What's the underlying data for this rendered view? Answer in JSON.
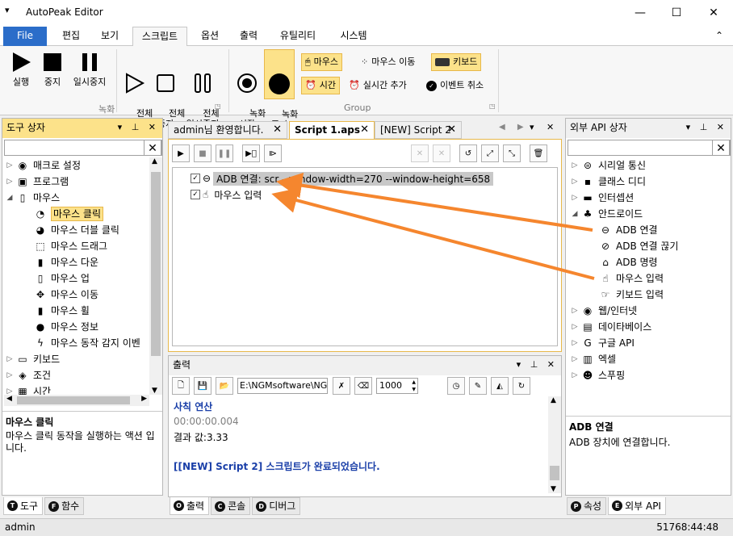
{
  "window": {
    "title": "AutoPeak Editor",
    "sysmenu_glyph": "▾",
    "min": "—",
    "max": "☐",
    "close": "✕"
  },
  "menu": {
    "file": "File",
    "tabs": [
      "편집",
      "보기",
      "스크립트",
      "옵션",
      "출력",
      "유틸리티",
      "시스템"
    ],
    "active": "스크립트",
    "collapse_glyph": "⌃"
  },
  "ribbon": {
    "run": "실행",
    "stop": "중지",
    "pause": "일시중지",
    "all_run": "전체\n실행",
    "all_stop": "전체\n중지",
    "all_pause": "전체\n일시중지",
    "rec_start": "녹화\n시작",
    "rec_stop": "녹화\n중지",
    "group_record": "녹화",
    "group_group": "Group",
    "mouse": "마우스",
    "mouse_move": "마우스 이동",
    "keyboard": "키보드",
    "time": "시간",
    "realtime_add": "실시간 추가",
    "event_cancel": "이벤트 취소"
  },
  "tool_panel": {
    "title": "도구 상자",
    "items": [
      {
        "label": "매크로 설정",
        "icon": "globe-icon",
        "glyph": "◉",
        "arrow": "▷",
        "indent": 0
      },
      {
        "label": "프로그램",
        "icon": "window-icon",
        "glyph": "▣",
        "arrow": "▷",
        "indent": 0
      },
      {
        "label": "마우스",
        "icon": "mouse-icon",
        "glyph": "▯",
        "arrow": "◢",
        "indent": 0
      },
      {
        "label": "마우스 클릭",
        "icon": "mouse-click-icon",
        "glyph": "◔",
        "arrow": "",
        "indent": 1,
        "highlight": true
      },
      {
        "label": "마우스 더블 클릭",
        "icon": "mouse-double-click-icon",
        "glyph": "◕",
        "arrow": "",
        "indent": 1
      },
      {
        "label": "마우스 드래그",
        "icon": "mouse-drag-icon",
        "glyph": "⬚",
        "arrow": "",
        "indent": 1
      },
      {
        "label": "마우스 다운",
        "icon": "mouse-down-icon",
        "glyph": "▮",
        "arrow": "",
        "indent": 1
      },
      {
        "label": "마우스 업",
        "icon": "mouse-up-icon",
        "glyph": "▯",
        "arrow": "",
        "indent": 1
      },
      {
        "label": "마우스 이동",
        "icon": "mouse-move-icon",
        "glyph": "✥",
        "arrow": "",
        "indent": 1
      },
      {
        "label": "마우스 휠",
        "icon": "mouse-wheel-icon",
        "glyph": "▮",
        "arrow": "",
        "indent": 1
      },
      {
        "label": "마우스 정보",
        "icon": "mouse-info-icon",
        "glyph": "●",
        "arrow": "",
        "indent": 1
      },
      {
        "label": "마우스 동작 감지 이벤",
        "icon": "bolt-icon",
        "glyph": "ϟ",
        "arrow": "",
        "indent": 1
      },
      {
        "label": "키보드",
        "icon": "keyboard-icon",
        "glyph": "▭",
        "arrow": "▷",
        "indent": 0
      },
      {
        "label": "조건",
        "icon": "condition-icon",
        "glyph": "◈",
        "arrow": "▷",
        "indent": 0
      },
      {
        "label": "시간",
        "icon": "calendar-icon",
        "glyph": "▦",
        "arrow": "▷",
        "indent": 0
      }
    ],
    "desc_title": "마우스 클릭",
    "desc_body": "마우스 클릭 동작을 실행하는 액션 입니다.",
    "tab_tool": "도구",
    "tab_tool_key": "T",
    "tab_func": "함수",
    "tab_func_key": "F"
  },
  "doc_tabs": [
    {
      "label": "admin님 환영합니다."
    },
    {
      "label": "Script 1.aps"
    },
    {
      "label": "[NEW] Script 2"
    }
  ],
  "script": {
    "lines": [
      {
        "text": "ADB 연결: scr    --window-width=270 --window-height=658",
        "icon": "link-icon"
      },
      {
        "text": "마우스 입력",
        "icon": "hand-pointer-icon"
      }
    ],
    "check": "✓"
  },
  "output": {
    "title": "출력",
    "path": "E:\\NGMsoftware\\NG",
    "number": "1000",
    "lines": [
      {
        "text": "사칙 연산",
        "color": "#1a3fa8",
        "bold": true
      },
      {
        "text": "00:00:00.004",
        "color": "#808080",
        "bold": false
      },
      {
        "text": "결과 값:3.33",
        "color": "#000000",
        "bold": false
      },
      {
        "text": "",
        "color": "#000000",
        "bold": false
      },
      {
        "text": "[[NEW] Script 2] 스크립트가 완료되었습니다.",
        "color": "#1a3fa8",
        "bold": true
      }
    ],
    "tab_output": "출력",
    "tab_output_key": "O",
    "tab_console": "콘솔",
    "tab_console_key": "C",
    "tab_debug": "디버그",
    "tab_debug_key": "D"
  },
  "api_panel": {
    "title": "외부 API 상자",
    "items": [
      {
        "label": "시리얼 통신",
        "icon": "serial-icon",
        "glyph": "⊜",
        "arrow": "▷",
        "indent": 0
      },
      {
        "label": "클래스 디디",
        "icon": "class-icon",
        "glyph": "▪",
        "arrow": "▷",
        "indent": 0
      },
      {
        "label": "인터셉션",
        "icon": "monitor-icon",
        "glyph": "▬",
        "arrow": "▷",
        "indent": 0
      },
      {
        "label": "안드로이드",
        "icon": "android-icon",
        "glyph": "♣",
        "arrow": "◢",
        "indent": 0
      },
      {
        "label": "ADB 연결",
        "icon": "link-icon",
        "glyph": "⊖",
        "arrow": "",
        "indent": 1
      },
      {
        "label": "ADB 연결 끊기",
        "icon": "unlink-icon",
        "glyph": "⊘",
        "arrow": "",
        "indent": 1
      },
      {
        "label": "ADB 명령",
        "icon": "home-icon",
        "glyph": "⌂",
        "arrow": "",
        "indent": 1
      },
      {
        "label": "마우스 입력",
        "icon": "hand-pointer-icon",
        "glyph": "☝",
        "arrow": "",
        "indent": 1
      },
      {
        "label": "키보드 입력",
        "icon": "hand-key-icon",
        "glyph": "☞",
        "arrow": "",
        "indent": 1
      },
      {
        "label": "웹/인터넷",
        "icon": "globe-icon",
        "glyph": "◉",
        "arrow": "▷",
        "indent": 0
      },
      {
        "label": "데이타베이스",
        "icon": "database-icon",
        "glyph": "▤",
        "arrow": "▷",
        "indent": 0
      },
      {
        "label": "구글 API",
        "icon": "google-icon",
        "glyph": "G",
        "arrow": "▷",
        "indent": 0
      },
      {
        "label": "엑셀",
        "icon": "excel-icon",
        "glyph": "▥",
        "arrow": "▷",
        "indent": 0
      },
      {
        "label": "스푸핑",
        "icon": "mask-icon",
        "glyph": "☻",
        "arrow": "▷",
        "indent": 0
      }
    ],
    "desc_title": "ADB 연결",
    "desc_body": "ADB 장치에 연결합니다.",
    "tab_props": "속성",
    "tab_props_key": "P",
    "tab_api": "외부 API",
    "tab_api_key": "E"
  },
  "status": {
    "user": "admin",
    "time": "51768:44:48"
  },
  "colors": {
    "accent": "#2b6dc9",
    "highlight": "#fce28a",
    "arrow": "#f5862e"
  }
}
